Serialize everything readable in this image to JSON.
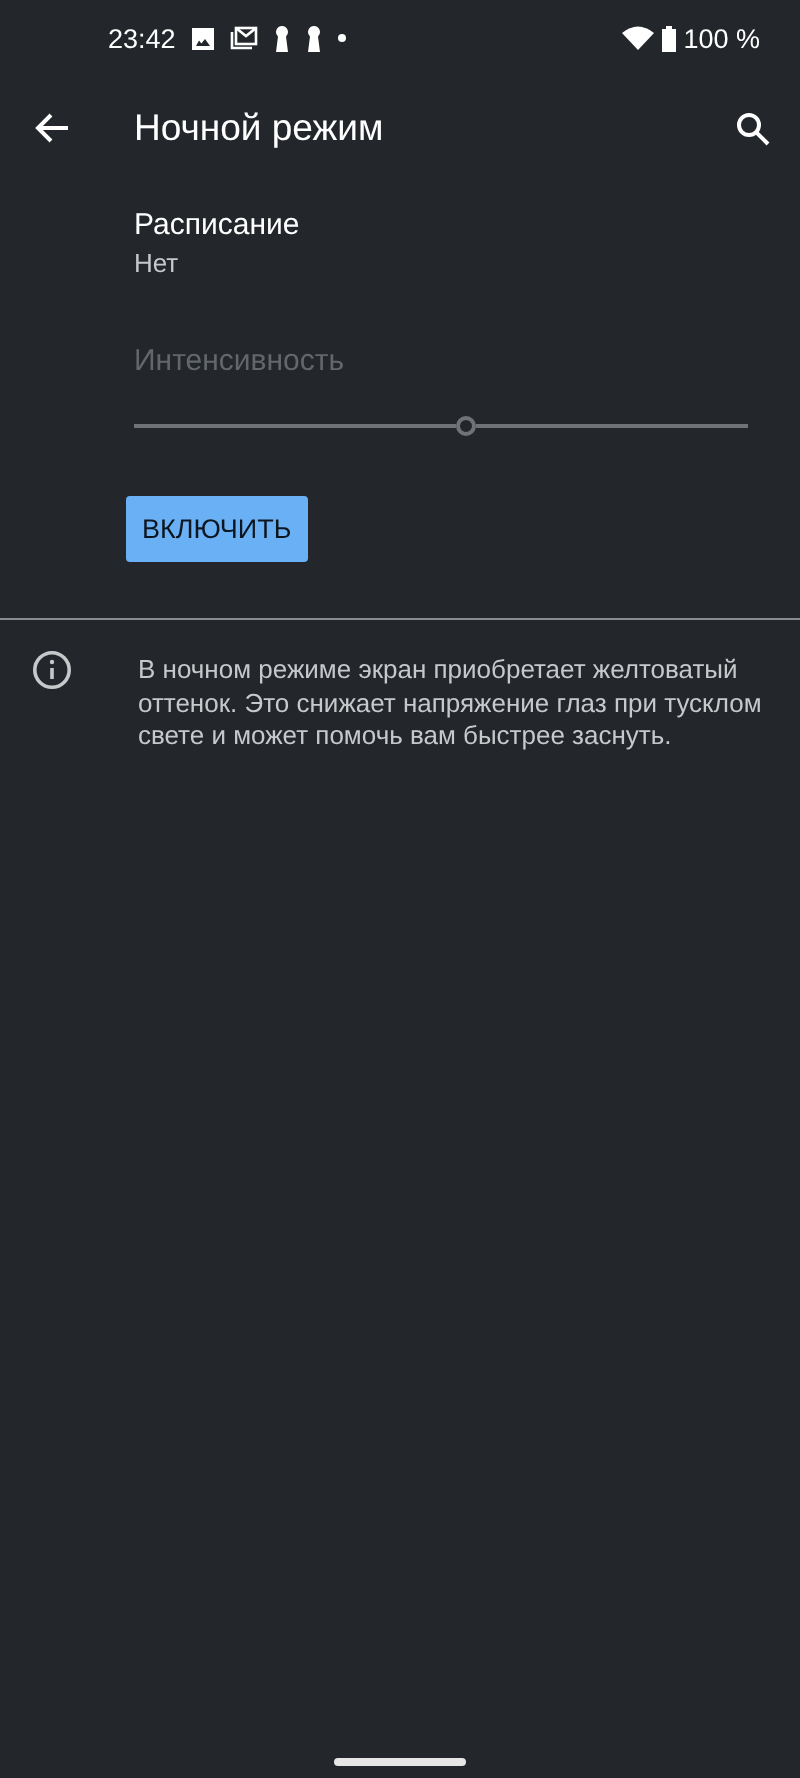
{
  "status_bar": {
    "time": "23:42",
    "battery": "100 %"
  },
  "app_bar": {
    "title": "Ночной режим"
  },
  "schedule": {
    "title": "Расписание",
    "value": "Нет"
  },
  "intensity": {
    "label": "Интенсивность",
    "level": 0.54,
    "disabled": true
  },
  "button": {
    "label": "ВКЛЮЧИТЬ"
  },
  "info": {
    "text": "В ночном режиме экран приобретает желтоватый оттенок. Это снижает напряжение глаз при тусклом свете и может помочь вам быстрее заснуть."
  }
}
